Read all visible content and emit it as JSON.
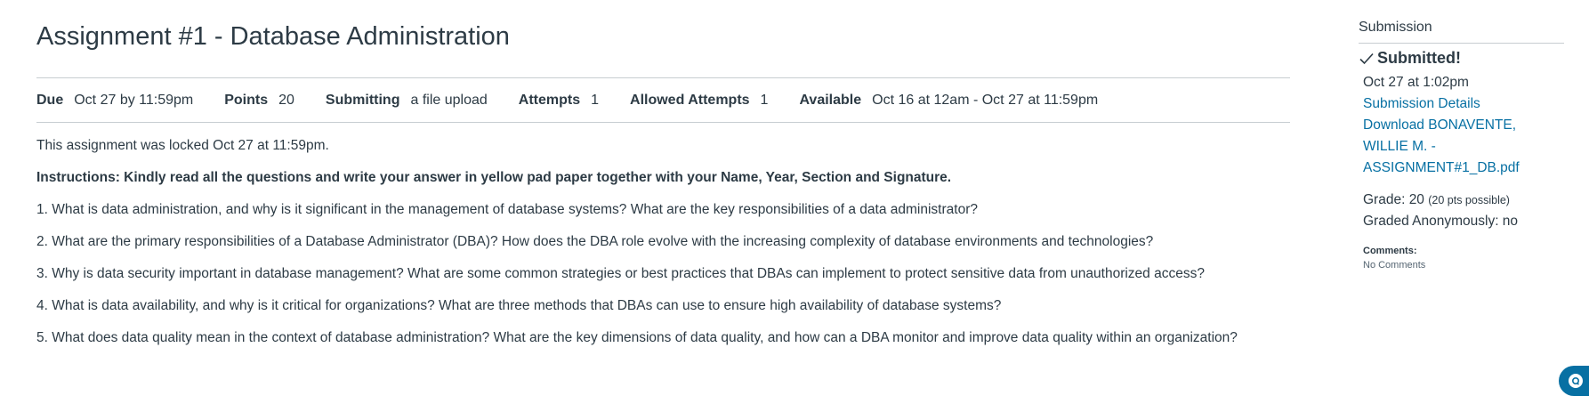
{
  "assignment": {
    "title": "Assignment #1 - Database Administration"
  },
  "meta": {
    "due_label": "Due",
    "due_value": "Oct 27 by 11:59pm",
    "points_label": "Points",
    "points_value": "20",
    "submitting_label": "Submitting",
    "submitting_value": "a file upload",
    "attempts_label": "Attempts",
    "attempts_value": "1",
    "allowed_attempts_label": "Allowed Attempts",
    "allowed_attempts_value": "1",
    "available_label": "Available",
    "available_value": "Oct 16 at 12am - Oct 27 at 11:59pm"
  },
  "content": {
    "locked_notice": "This assignment was locked Oct 27 at 11:59pm.",
    "instructions": "Instructions: Kindly read all the questions and write your answer in yellow pad paper together with your Name, Year, Section and Signature.",
    "questions": [
      "1. What is data administration, and why is it significant in the management of database systems? What are the key responsibilities of a data administrator?",
      "2. What are the primary responsibilities of a Database Administrator (DBA)? How does the DBA role evolve with the increasing complexity of database environments and technologies?",
      "3. Why is data security important in database management? What are some common strategies or best practices that DBAs can implement to protect sensitive data from unauthorized access?",
      "4. What is data availability, and why is it critical for organizations? What are three methods that DBAs can use to ensure high availability of database systems?",
      "5. What does data quality mean in the context of database administration? What are the key dimensions of data quality, and how can a DBA monitor and improve data quality within an organization?"
    ]
  },
  "sidebar": {
    "heading": "Submission",
    "status": "Submitted!",
    "submitted_at": "Oct 27 at 1:02pm",
    "details_link": "Submission Details",
    "download_link_line1": "Download BONAVENTE,",
    "download_link_line2": "WILLIE M. -",
    "download_link_line3": "ASSIGNMENT#1_DB.pdf",
    "grade_label": "Grade: 20",
    "grade_possible": "(20 pts possible)",
    "graded_anonymously": "Graded Anonymously: no",
    "comments_label": "Comments:",
    "comments_value": "No Comments"
  },
  "icons": {
    "status_icon": "checkmark-icon",
    "help_icon": "help-chat-icon"
  },
  "colors": {
    "link": "#0770a3",
    "text": "#2d3b45",
    "divider": "#c7cdd1"
  }
}
